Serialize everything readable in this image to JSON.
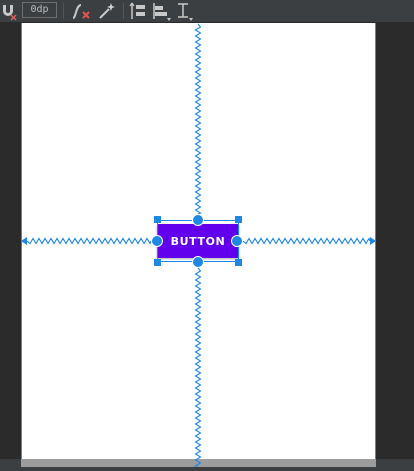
{
  "toolbar": {
    "default_margin": "0dp",
    "icons": [
      "magnet-icon",
      "clear-constraints-icon",
      "infer-constraints-icon",
      "pack-icon",
      "align-icon",
      "guidelines-icon"
    ]
  },
  "layout": {
    "button_label": "BUTTON"
  },
  "colors": {
    "button": "#6200ee",
    "constraint": "#1e88e5",
    "canvas": "#ffffff",
    "editor_background": "#2b2b2b"
  }
}
